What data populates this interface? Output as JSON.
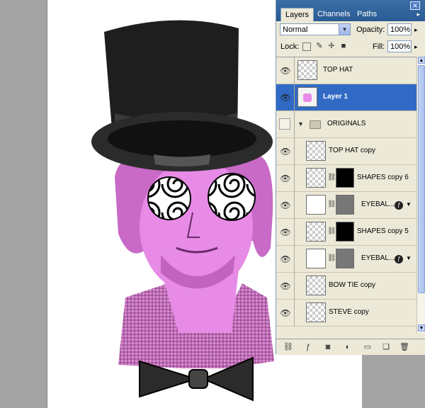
{
  "panel": {
    "tabs": [
      {
        "label": "Layers",
        "active": true
      },
      {
        "label": "Channels",
        "active": false
      },
      {
        "label": "Paths",
        "active": false
      }
    ],
    "blend_mode": "Normal",
    "opacity_label": "Opacity:",
    "opacity_value": "100%",
    "lock_label": "Lock:",
    "fill_label": "Fill:",
    "fill_value": "100%"
  },
  "layers": [
    {
      "name": "TOP HAT",
      "visible": true,
      "selected": false
    },
    {
      "name": "Layer 1",
      "visible": true,
      "selected": true
    },
    {
      "name": "ORIGINALS",
      "visible": false,
      "type": "group"
    },
    {
      "name": "TOP HAT copy",
      "visible": true
    },
    {
      "name": "SHAPES copy 6",
      "visible": true,
      "has_mask": true
    },
    {
      "name": "EYEBAL...",
      "visible": true,
      "has_mask": true,
      "has_fx": true
    },
    {
      "name": "SHAPES copy 5",
      "visible": true,
      "has_mask": true
    },
    {
      "name": "EYEBAL...",
      "visible": true,
      "has_mask": true,
      "has_fx": true
    },
    {
      "name": "BOW TIE copy",
      "visible": true
    },
    {
      "name": "STEVE copy",
      "visible": true
    }
  ],
  "colors": {
    "selected_row": "#316ac5",
    "panel_bg": "#ece9d8",
    "skin": "#e78be6"
  }
}
